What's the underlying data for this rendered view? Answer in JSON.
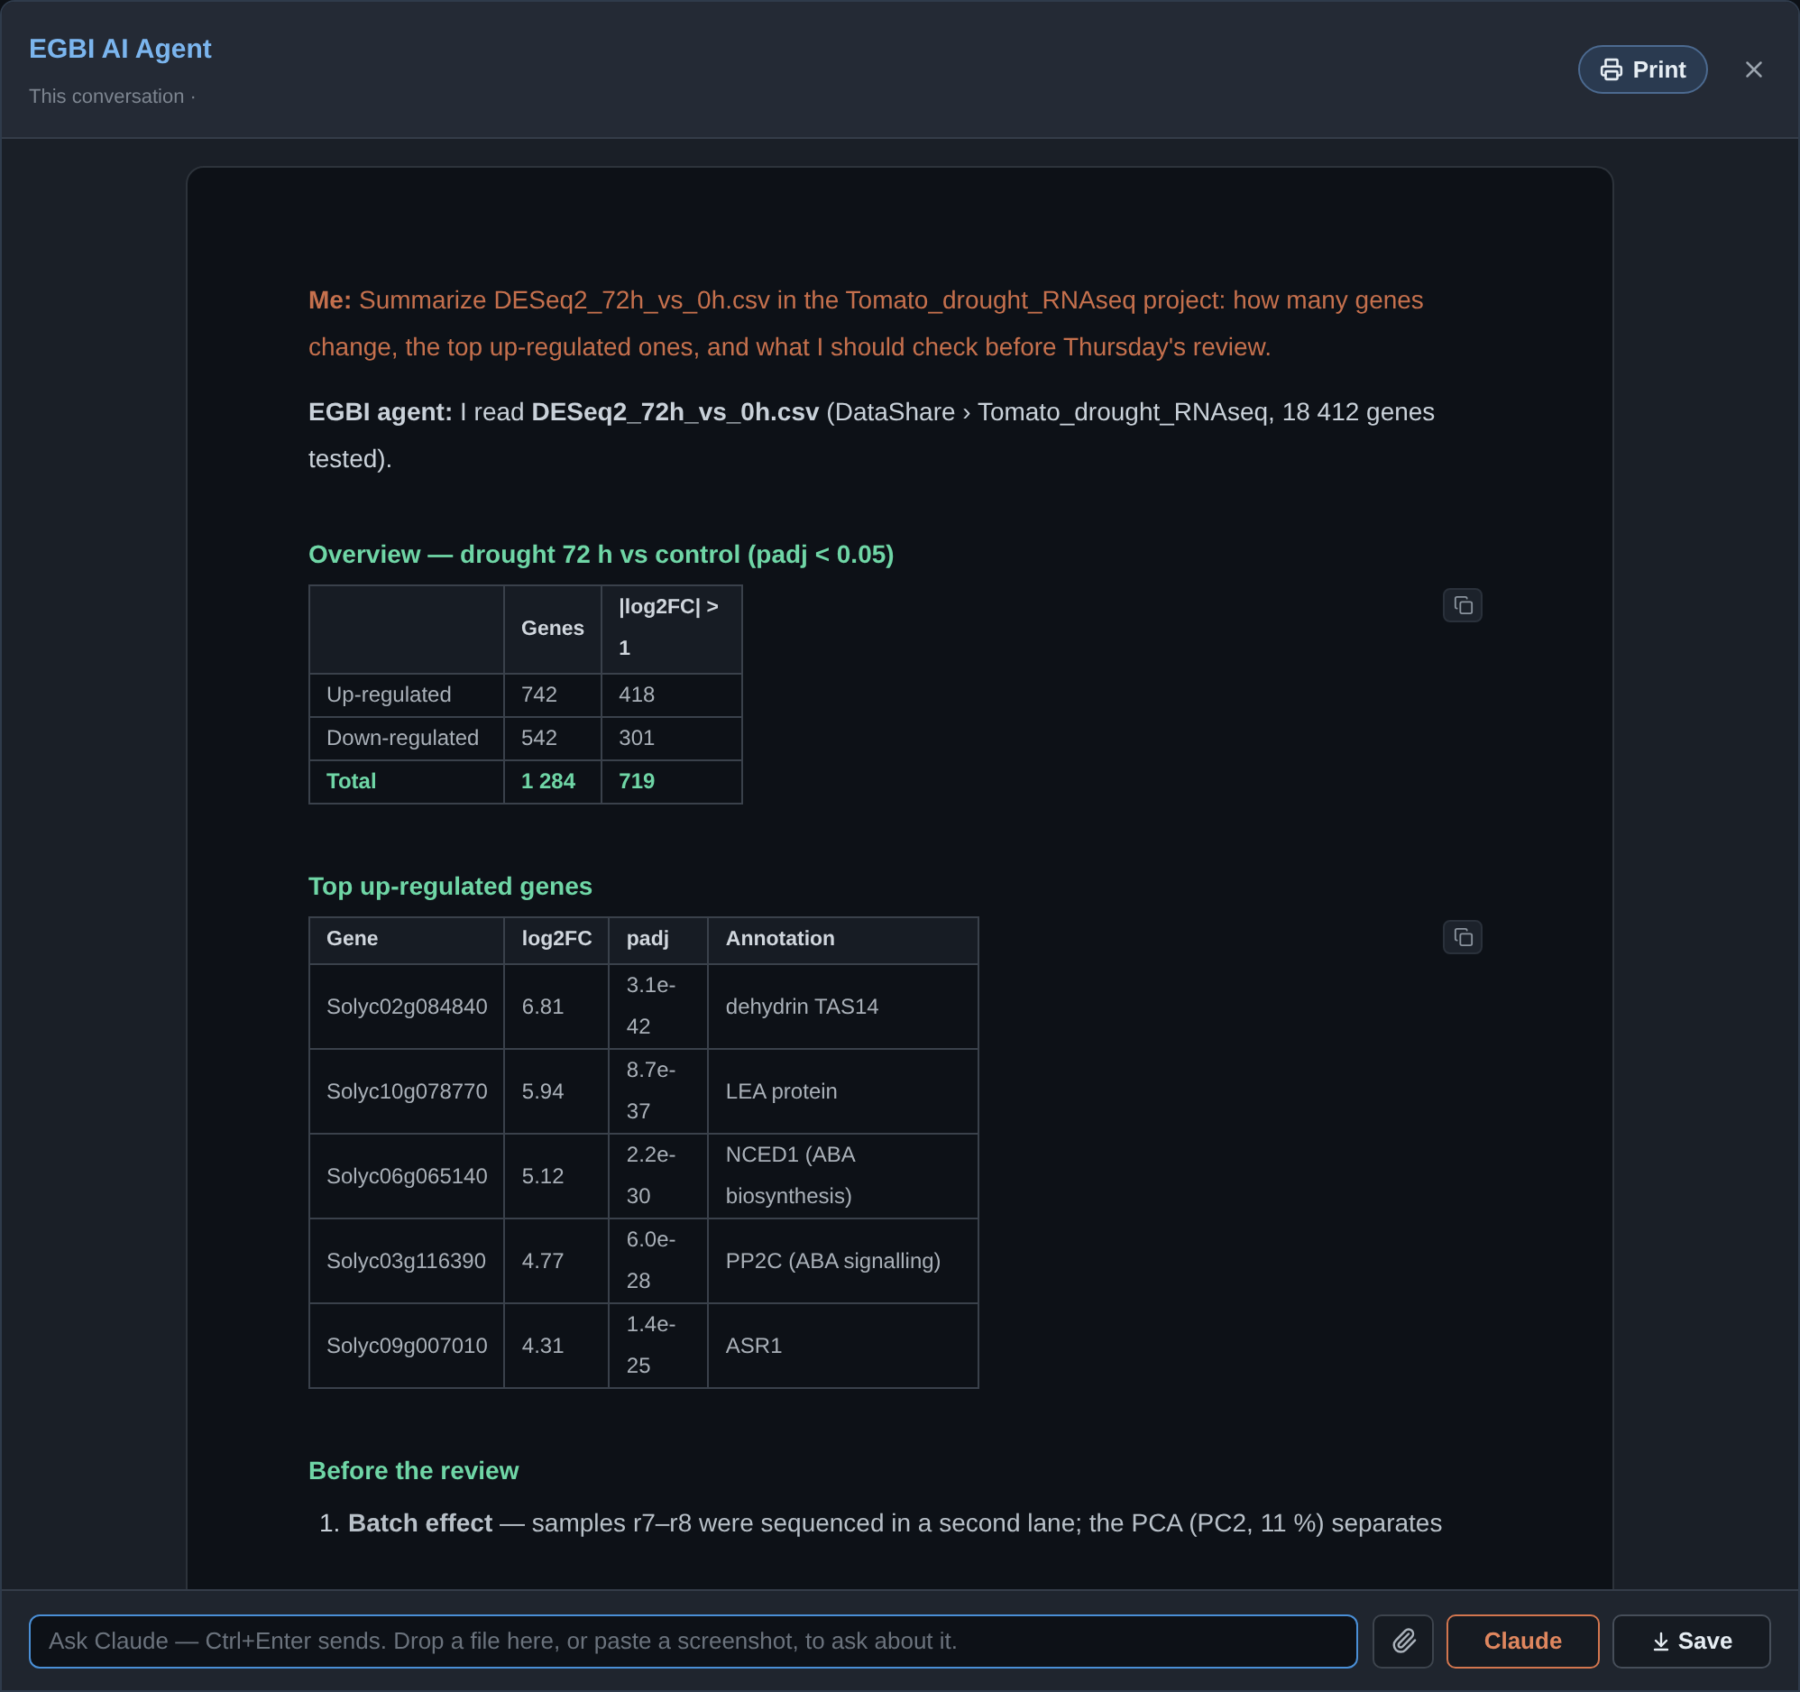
{
  "window": {
    "title": "EGBI AI Agent",
    "subtitle": "This conversation ·",
    "print_label": "Print"
  },
  "messages": [
    {
      "kind": "user",
      "text": "**Me:** Summarize DESeq2_72h_vs_0h.csv in the Tomato_drought_RNAseq project: how many genes change, the top up-regulated ones, and what I should check before Thursday's review."
    },
    {
      "kind": "agent",
      "text": "**EGBI agent:** I read **DESeq2_72h_vs_0h.csv** (DataShare › Tomato_drought_RNAseq, 18 412 genes tested)."
    }
  ],
  "sections": [
    {
      "kind": "table",
      "heading": "Overview — drought 72 h vs control (padj < 0.05)",
      "columns": [
        "Genes",
        "|log2FC| > 1"
      ],
      "rows": [
        {
          "kind": "normal",
          "label": "Up-regulated",
          "cells": [
            "742",
            "418"
          ]
        },
        {
          "kind": "normal",
          "label": "Down-regulated",
          "cells": [
            "542",
            "301"
          ]
        },
        {
          "kind": "total",
          "label": "Total",
          "cells": [
            "1 284",
            "719"
          ]
        }
      ]
    },
    {
      "kind": "table",
      "heading": "Top up-regulated genes",
      "columns": [
        "Gene",
        "log2FC",
        "padj",
        "Annotation"
      ],
      "rows": [
        {
          "kind": "normal",
          "cells": [
            "Solyc02g084840",
            "6.81",
            "3.1e-42",
            "dehydrin TAS14"
          ]
        },
        {
          "kind": "normal",
          "cells": [
            "Solyc10g078770",
            "5.94",
            "8.7e-37",
            "LEA protein"
          ]
        },
        {
          "kind": "normal",
          "cells": [
            "Solyc06g065140",
            "5.12",
            "2.2e-30",
            "NCED1 (ABA biosynthesis)"
          ]
        },
        {
          "kind": "normal",
          "cells": [
            "Solyc03g116390",
            "4.77",
            "6.0e-28",
            "PP2C (ABA signalling)"
          ]
        },
        {
          "kind": "normal",
          "cells": [
            "Solyc09g007010",
            "4.31",
            "1.4e-25",
            "ASR1"
          ]
        }
      ]
    },
    {
      "kind": "list",
      "heading": "Before the review",
      "items": [
        {
          "number": "1.",
          "text": "**Batch effect** — samples r7–r8 were sequenced in a second lane; the PCA (PC2, 11 %) separates"
        }
      ]
    }
  ],
  "composer": {
    "placeholder": "Ask Claude — Ctrl+Enter sends. Drop a file here, or paste a screenshot, to ask about it.",
    "model_label": "Claude",
    "save_label": "Save"
  }
}
